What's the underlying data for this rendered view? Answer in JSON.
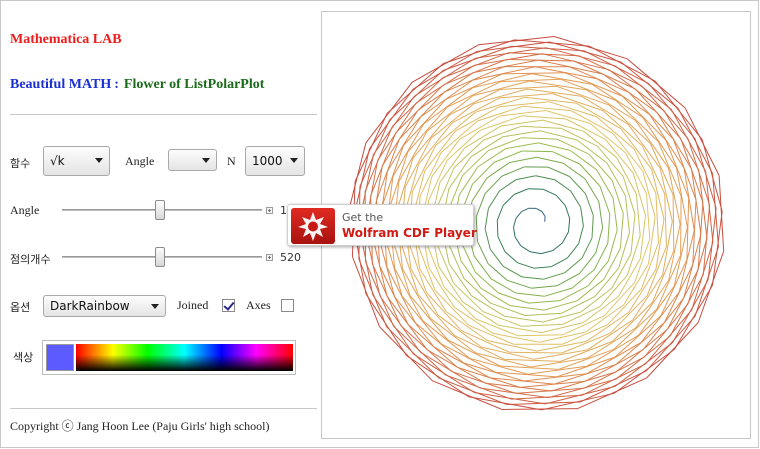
{
  "header": {
    "lab_title": "Mathematica LAB",
    "subtitle_main": "Beautiful MATH",
    "subtitle_sep": ":",
    "subtitle_topic": "Flower of ListPolarPlot"
  },
  "controls": {
    "function_label": "함수",
    "function_value": "√k",
    "angle_label": "Angle",
    "angle_select_value": "",
    "n_label": "N",
    "n_value": "1000",
    "angle_slider_label": "Angle",
    "angle_slider_value_text": "1.",
    "angle_slider_level": 0.49,
    "points_label": "점의개수",
    "points_value": "520",
    "points_slider_level": 0.49,
    "option_label": "옵션",
    "option_value": "DarkRainbow",
    "joined_label": "Joined",
    "joined_checked": true,
    "axes_label": "Axes",
    "axes_checked": false,
    "color_label": "색상",
    "swatch_color": "#5b5bff"
  },
  "footer": {
    "copyright": "Copyright ⓒ Jang Hoon Lee (Paju Girls' high school)"
  },
  "cdf_banner": {
    "line1": "Get the",
    "line2": "Wolfram CDF Player"
  },
  "colors": {
    "title_red": "#ee1d1d",
    "title_blue": "#1a2fd6",
    "title_green": "#1b6b1b",
    "palette": [
      "#3b55a4",
      "#2e7a55",
      "#8fb84a",
      "#e0c86a",
      "#e39a54",
      "#c64a3e"
    ]
  }
}
